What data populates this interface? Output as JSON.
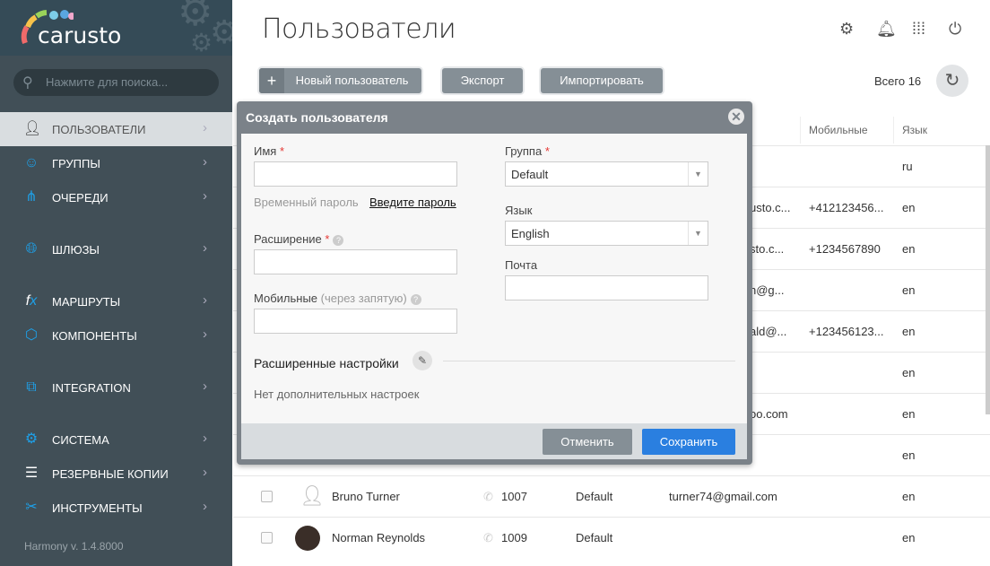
{
  "brand": {
    "logo_text": "carusto"
  },
  "search": {
    "placeholder": "Нажмите для поиска..."
  },
  "sidebar": {
    "items": [
      {
        "label": "ПОЛЬЗОВАТЕЛИ",
        "icon": "user-icon",
        "active": true
      },
      {
        "label": "ГРУППЫ",
        "icon": "group-icon"
      },
      {
        "label": "ОЧЕРЕДИ",
        "icon": "queue-icon"
      },
      {
        "label": "ШЛЮЗЫ",
        "icon": "globe-icon"
      },
      {
        "label": "МАРШРУТЫ",
        "icon": "fx-icon"
      },
      {
        "label": "КОМПОНЕНТЫ",
        "icon": "cube-icon"
      },
      {
        "label": "INTEGRATION",
        "icon": "integration-icon"
      },
      {
        "label": "СИСТЕМА",
        "icon": "gear-icon"
      },
      {
        "label": "РЕЗЕРВНЫЕ КОПИИ",
        "icon": "database-icon"
      },
      {
        "label": "ИНСТРУМЕНТЫ",
        "icon": "tools-icon"
      }
    ],
    "version": "Harmony v. 1.4.8000"
  },
  "header": {
    "title": "Пользователи",
    "icons": [
      "settings-icon",
      "bell-icon",
      "apps-grid-icon",
      "power-icon"
    ]
  },
  "toolbar": {
    "new_user": "Новый пользователь",
    "export": "Экспорт",
    "import": "Импортировать",
    "total": "Всего 16"
  },
  "table": {
    "headers": {
      "mobile": "Мобильные",
      "lang": "Язык"
    },
    "rows": [
      {
        "email": "",
        "mobile": "",
        "lang": "ru"
      },
      {
        "email": "usto.c...",
        "mobile": "+412123456...",
        "lang": "en"
      },
      {
        "email": "sto.c...",
        "mobile": "+1234567890",
        "lang": "en"
      },
      {
        "email": "n@g...",
        "mobile": "",
        "lang": "en"
      },
      {
        "email": "ald@...",
        "mobile": "+123456123...",
        "lang": "en"
      },
      {
        "email": "",
        "mobile": "",
        "lang": "en"
      },
      {
        "email": "oo.com",
        "mobile": "",
        "lang": "en"
      },
      {
        "email": "",
        "mobile": "",
        "lang": "en"
      },
      {
        "name": "Bruno Turner",
        "ext": "1007",
        "group": "Default",
        "email": "turner74@gmail.com",
        "mobile": "",
        "lang": "en"
      },
      {
        "name": "Norman Reynolds",
        "ext": "1009",
        "group": "Default",
        "email": "",
        "mobile": "",
        "lang": "en"
      }
    ]
  },
  "modal": {
    "title": "Создать пользователя",
    "name_label": "Имя",
    "temp_password_label": "Временный пароль",
    "enter_password_link": "Введите пароль",
    "extension_label": "Расширение",
    "mobile_label": "Мобильные",
    "mobile_hint": "(через запятую)",
    "group_label": "Группа",
    "group_value": "Default",
    "language_label": "Язык",
    "language_value": "English",
    "email_label": "Почта",
    "advanced_label": "Расширенные настройки",
    "no_advanced": "Нет дополнительных настроек",
    "cancel": "Отменить",
    "save": "Сохранить",
    "required_mark": "*"
  },
  "colors": {
    "sidebar": "#414f57",
    "accent": "#1ea0e8",
    "save": "#2a7fe0",
    "button": "#858f96"
  }
}
